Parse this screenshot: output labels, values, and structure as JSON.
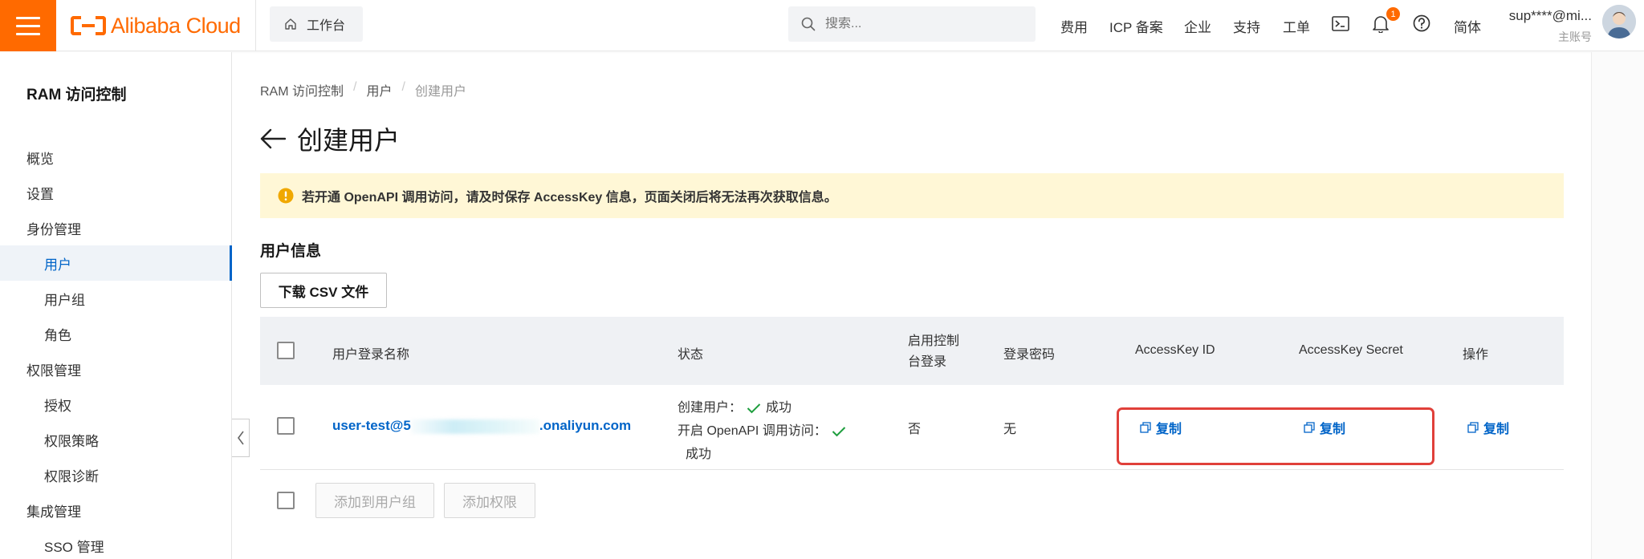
{
  "header": {
    "logo_text": "Alibaba Cloud",
    "workbench_label": "工作台",
    "search_placeholder": "搜索...",
    "nav": {
      "billing": "费用",
      "icp": "ICP 备案",
      "enterprise": "企业",
      "support": "支持",
      "ticket": "工单",
      "language": "简体"
    },
    "notification_count": "1",
    "account_name": "sup****@mi...",
    "account_type": "主账号"
  },
  "sidebar": {
    "title": "RAM 访问控制",
    "items": [
      {
        "label": "概览",
        "level": "group"
      },
      {
        "label": "设置",
        "level": "group"
      },
      {
        "label": "身份管理",
        "level": "group"
      },
      {
        "label": "用户",
        "level": "sub",
        "active": true
      },
      {
        "label": "用户组",
        "level": "sub"
      },
      {
        "label": "角色",
        "level": "sub"
      },
      {
        "label": "权限管理",
        "level": "group"
      },
      {
        "label": "授权",
        "level": "sub"
      },
      {
        "label": "权限策略",
        "level": "sub"
      },
      {
        "label": "权限诊断",
        "level": "sub"
      },
      {
        "label": "集成管理",
        "level": "group"
      },
      {
        "label": "SSO 管理",
        "level": "sub"
      }
    ]
  },
  "breadcrumb": {
    "root": "RAM 访问控制",
    "parent": "用户",
    "current": "创建用户",
    "separator": "/"
  },
  "page": {
    "title": "创建用户",
    "notice": "若开通 OpenAPI 调用访问，请及时保存 AccessKey 信息，页面关闭后将无法再次获取信息。",
    "section_title": "用户信息",
    "download_csv": "下载 CSV 文件"
  },
  "table": {
    "columns": {
      "login_name": "用户登录名称",
      "status": "状态",
      "console_login_line1": "启用控制",
      "console_login_line2": "台登录",
      "password": "登录密码",
      "access_key_id": "AccessKey ID",
      "access_key_secret": "AccessKey Secret",
      "actions": "操作"
    },
    "row": {
      "login_name_prefix": "user-test@5",
      "login_name_suffix": ".onaliyun.com",
      "status_create_label": "创建用户：",
      "status_create_result": "成功",
      "status_openapi_label": "开启 OpenAPI 调用访问：",
      "status_openapi_result": "成功",
      "console_login": "否",
      "password": "无",
      "copy_id": "复制",
      "copy_secret": "复制",
      "copy_action": "复制"
    },
    "footer": {
      "add_to_group": "添加到用户组",
      "add_permission": "添加权限"
    }
  },
  "colors": {
    "brand": "#ff6a00",
    "link": "#0064c8",
    "success": "#1e9e3e",
    "notice_bg": "#fff7d6",
    "highlight": "#e0403a"
  }
}
